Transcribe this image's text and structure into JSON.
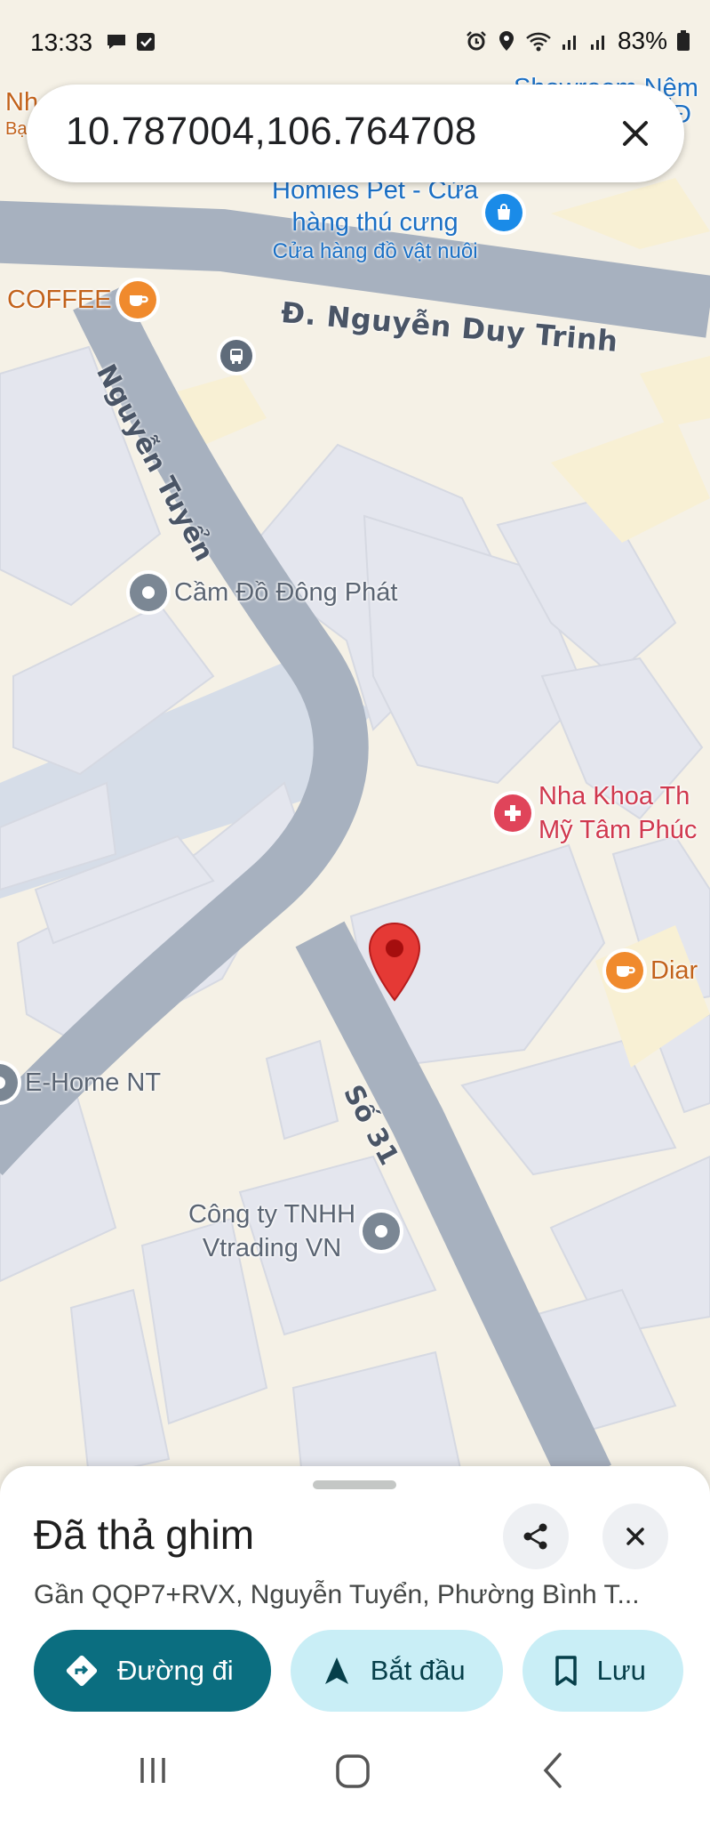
{
  "status_bar": {
    "time": "13:33",
    "battery": "83%"
  },
  "search": {
    "query": "10.787004,106.764708"
  },
  "map": {
    "roads": [
      {
        "name": "Đ. Nguyễn Duy Trinh"
      },
      {
        "name": "Nguyễn Tuyển"
      },
      {
        "name": "Số 31"
      }
    ],
    "pois": [
      {
        "name": "Cầm Đồ Đông Phát",
        "color": "#7b8794"
      },
      {
        "name": "E-Home NT",
        "color": "#7b8794"
      },
      {
        "line1": "Công ty TNHH",
        "line2": "Vtrading VN",
        "color": "#7b8794"
      },
      {
        "line1": "Nha Khoa Th",
        "line2": "Mỹ Tâm Phúc",
        "color": "#e0445a"
      },
      {
        "name": "Diar",
        "color": "#f08a2d"
      },
      {
        "name": "COFFEE",
        "color": "#f08a2d"
      },
      {
        "line1": "Homies Pet - Cửa",
        "line2": "hàng thú cưng",
        "sub": "Cửa hàng đồ vật nuôi",
        "color": "#1a8be8"
      },
      {
        "name": "Showroom Nệm",
        "partial": "n Đ"
      },
      {
        "name": "Nh",
        "sub": "Bạ"
      }
    ],
    "dropped_pin_color": "#e53935"
  },
  "sheet": {
    "title": "Đã thả ghim",
    "address": "Gần QQP7+RVX, Nguyễn Tuyển, Phường Bình T...",
    "actions": [
      {
        "label": "Đường đi",
        "icon": "directions-icon"
      },
      {
        "label": "Bắt đầu",
        "icon": "navigation-arrow-icon"
      },
      {
        "label": "Lưu",
        "icon": "bookmark-icon"
      }
    ]
  },
  "colors": {
    "primary": "#0b6e80",
    "secondary": "#c9eef6",
    "road": "#a7b1bf",
    "block": "#e4e6ee",
    "land": "#f5f1e6"
  }
}
